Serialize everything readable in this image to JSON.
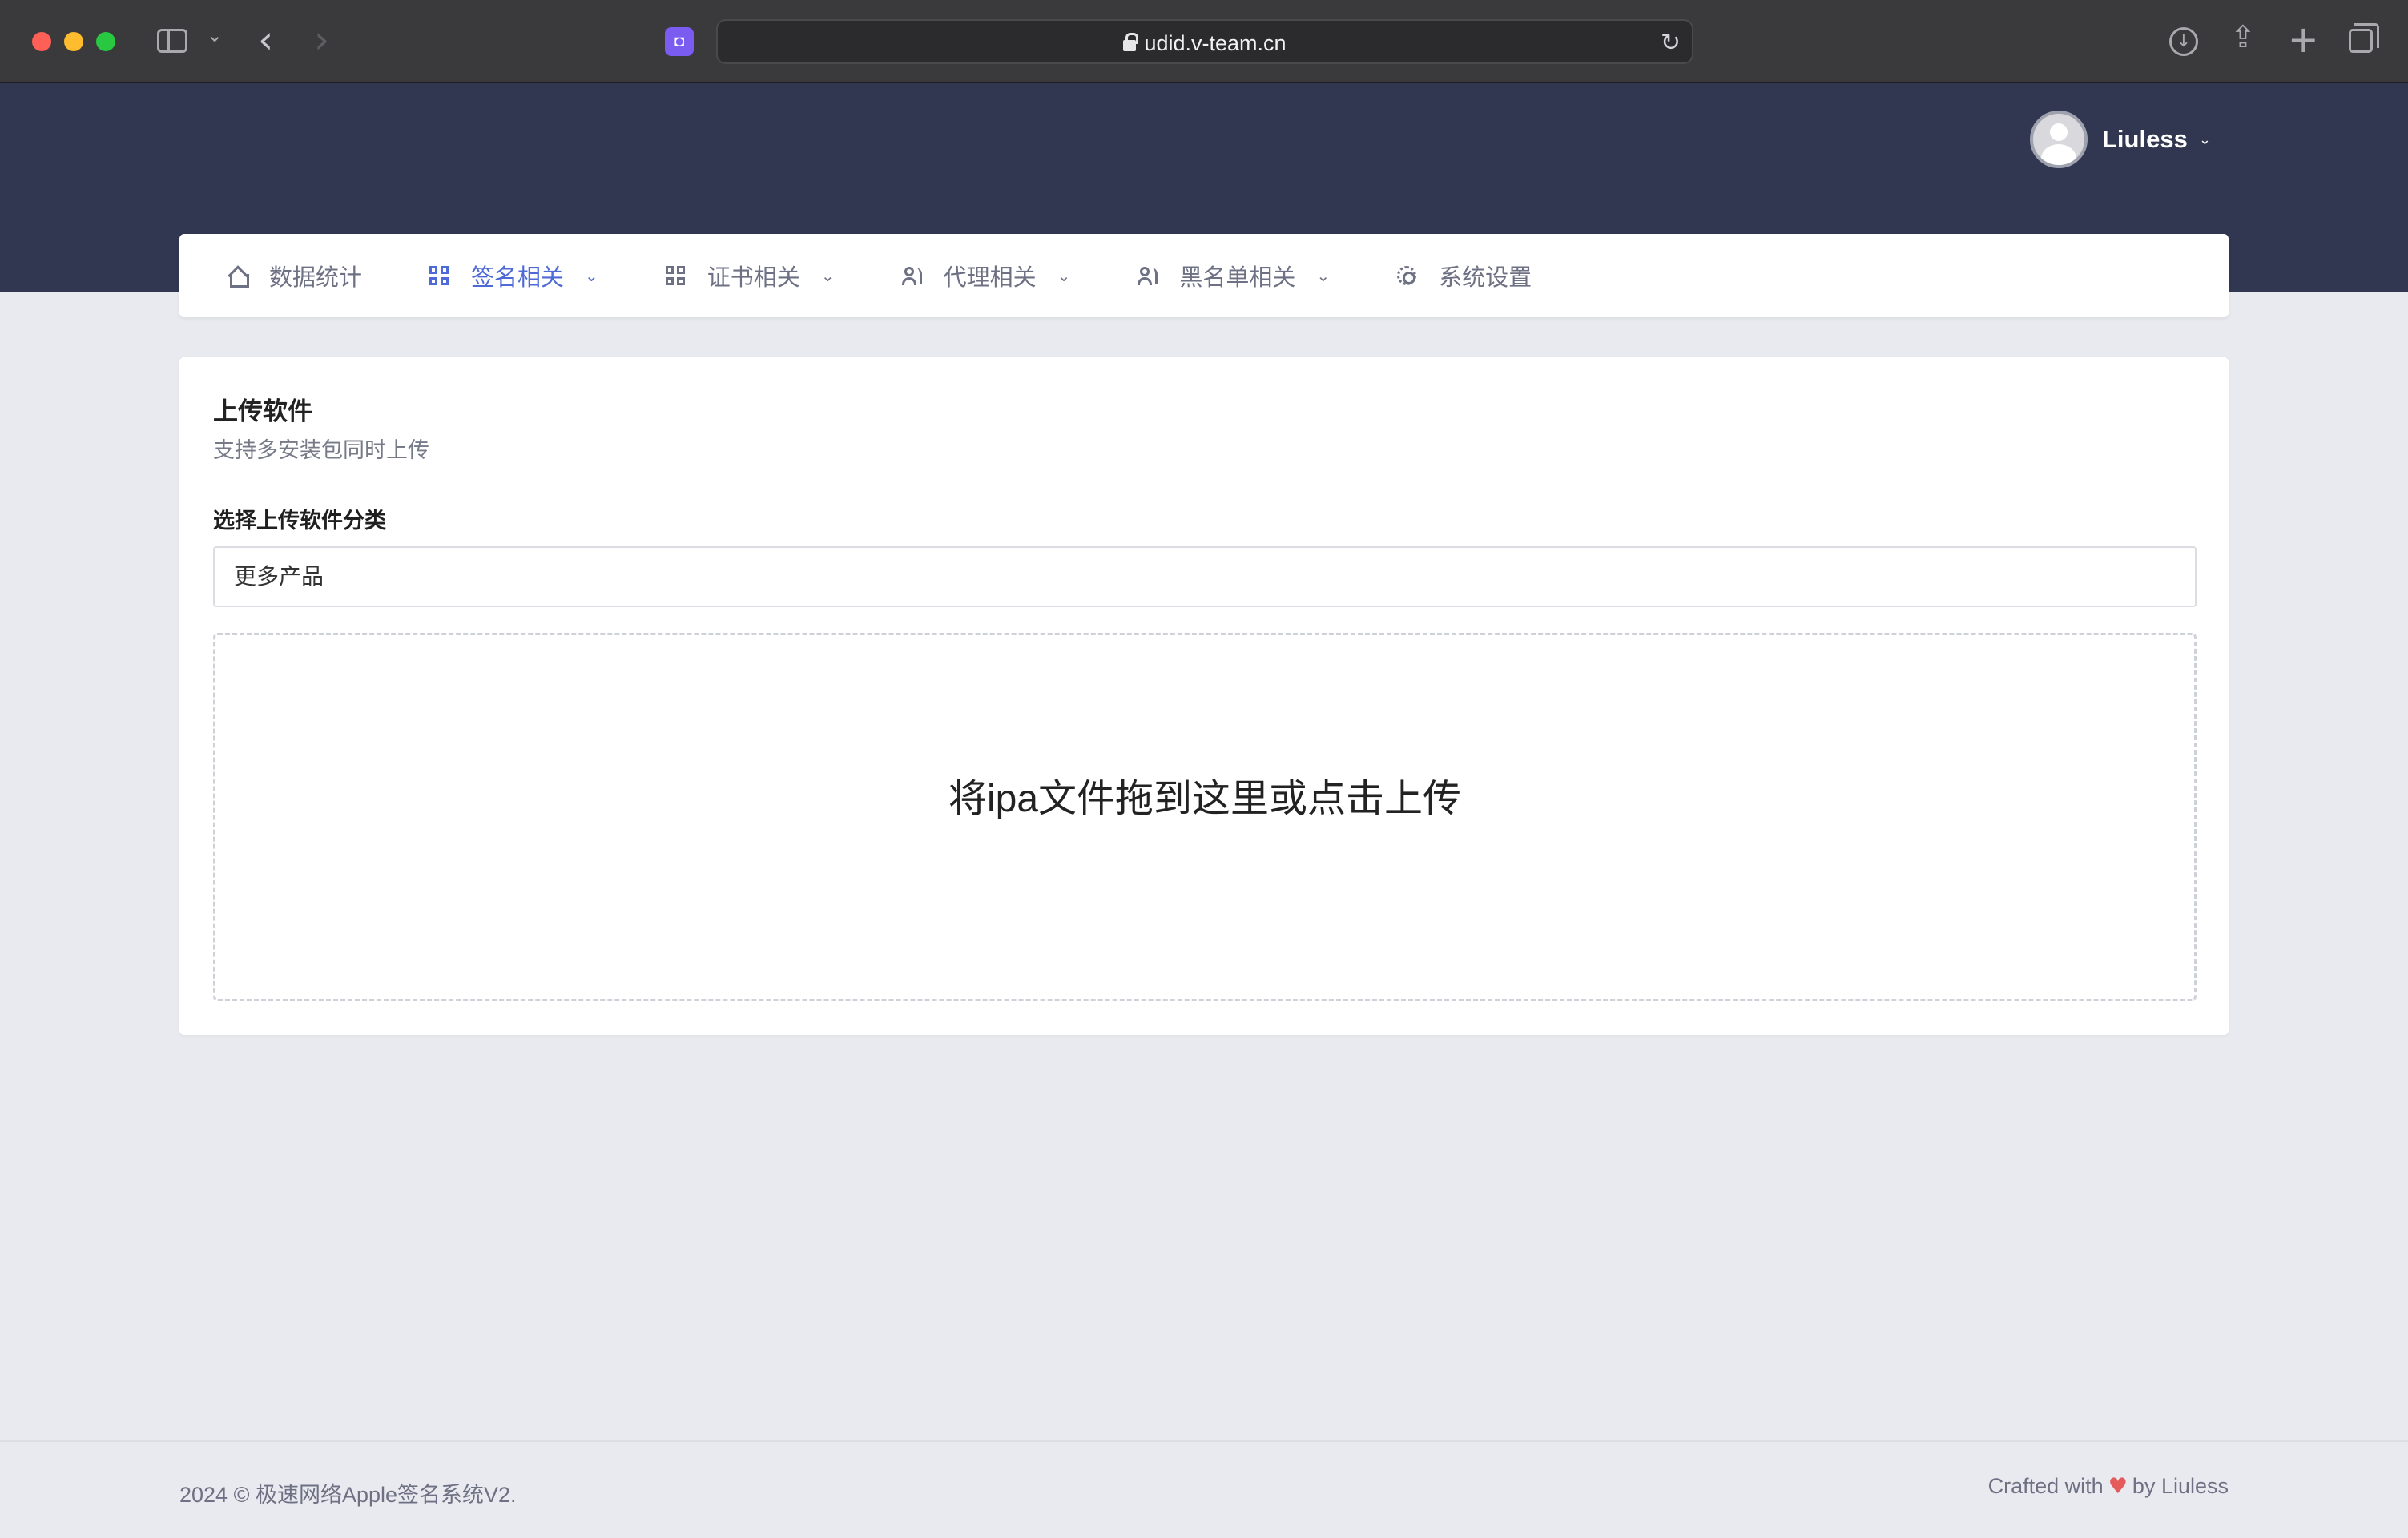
{
  "browser": {
    "url": "udid.v-team.cn"
  },
  "header": {
    "user_name": "Liuless"
  },
  "nav": {
    "items": [
      {
        "label": "数据统计",
        "icon": "home-icon",
        "has_dropdown": false,
        "active": false
      },
      {
        "label": "签名相关",
        "icon": "grid-icon",
        "has_dropdown": true,
        "active": true
      },
      {
        "label": "证书相关",
        "icon": "grid-icon",
        "has_dropdown": true,
        "active": false
      },
      {
        "label": "代理相关",
        "icon": "users-icon",
        "has_dropdown": true,
        "active": false
      },
      {
        "label": "黑名单相关",
        "icon": "users-icon",
        "has_dropdown": true,
        "active": false
      },
      {
        "label": "系统设置",
        "icon": "gear-icon",
        "has_dropdown": false,
        "active": false
      }
    ]
  },
  "upload": {
    "title": "上传软件",
    "subtitle": "支持多安装包同时上传",
    "category_label": "选择上传软件分类",
    "category_value": "更多产品",
    "dropzone_text": "将ipa文件拖到这里或点击上传"
  },
  "footer": {
    "copyright": "2024 © 极速网络Apple签名系统V2.",
    "crafted_prefix": "Crafted with",
    "crafted_suffix": "by Liuless"
  },
  "colors": {
    "header_bg": "#313750",
    "page_bg": "#e9eaef",
    "active_nav": "#4e6ad6",
    "heart": "#e45b5b"
  }
}
